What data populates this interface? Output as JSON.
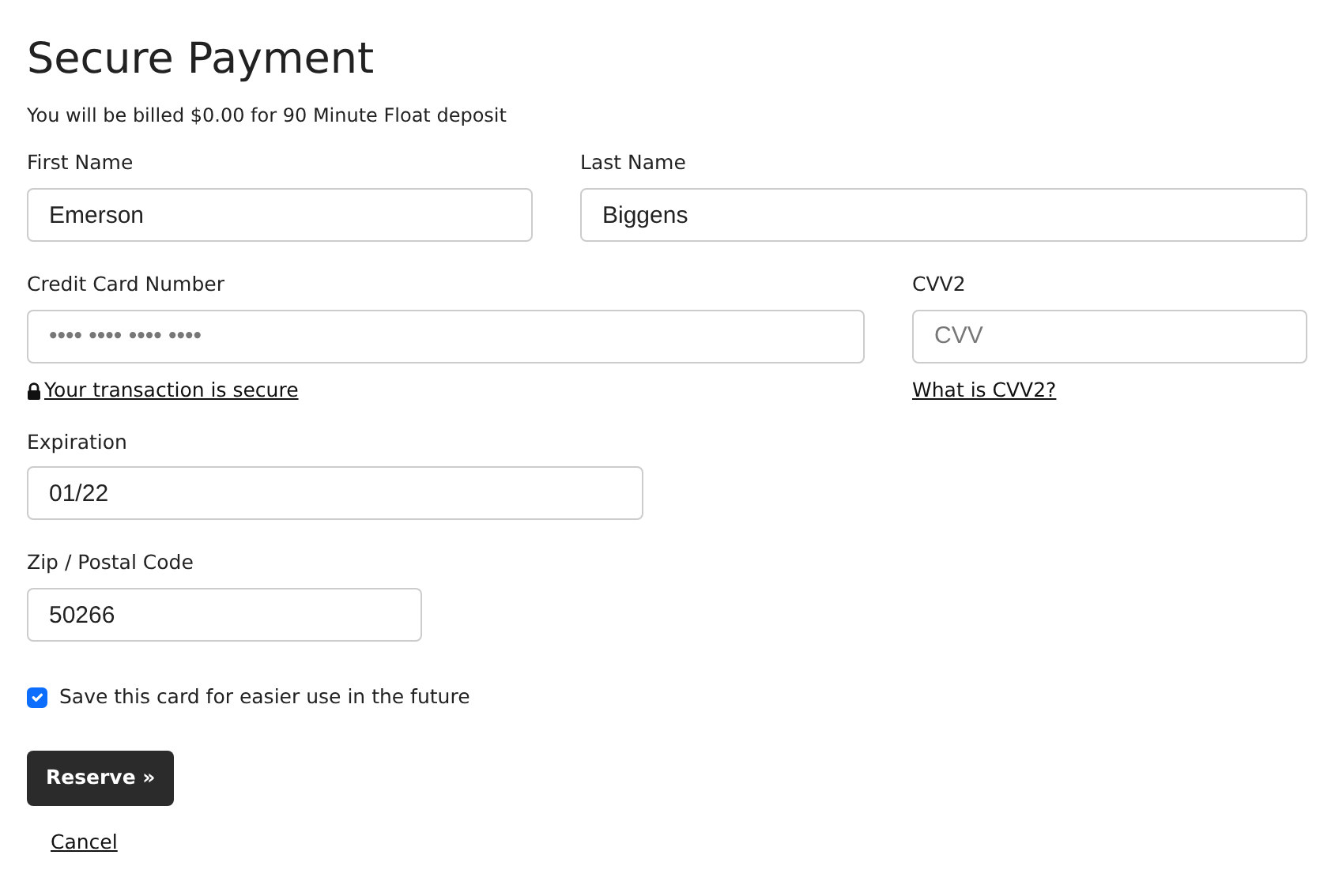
{
  "title": "Secure Payment",
  "subtitle": "You will be billed $0.00 for 90 Minute Float deposit",
  "first_name": {
    "label": "First Name",
    "value": "Emerson"
  },
  "last_name": {
    "label": "Last Name",
    "value": "Biggens"
  },
  "card_number": {
    "label": "Credit Card Number",
    "placeholder": "•••• •••• •••• ••••"
  },
  "secure_link": "Your transaction is secure",
  "cvv": {
    "label": "CVV2",
    "placeholder": "CVV"
  },
  "cvv_link": "What is CVV2?",
  "expiration": {
    "label": "Expiration",
    "value": "01/22"
  },
  "zip": {
    "label": "Zip / Postal Code",
    "value": "50266"
  },
  "save_card": {
    "label": "Save this card for easier use in the future",
    "checked": true
  },
  "reserve_button": "Reserve »",
  "cancel_link": "Cancel"
}
